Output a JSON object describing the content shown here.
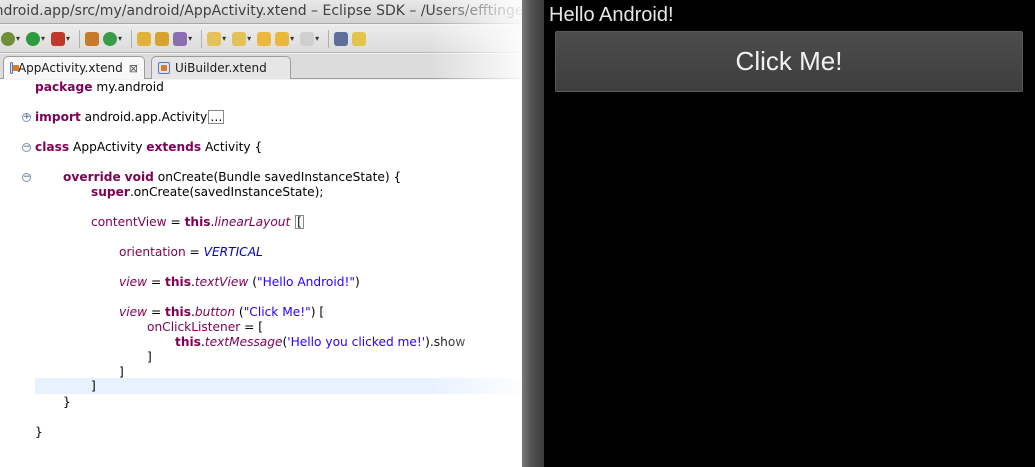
{
  "eclipse": {
    "title": "android.app/src/my/android/AppActivity.xtend – Eclipse SDK – /Users/efftinge/Doc",
    "tabs": [
      {
        "label": "AppActivity.xtend",
        "close": "⊠",
        "active": true
      },
      {
        "label": "UiBuilder.xtend",
        "active": false
      }
    ],
    "code": {
      "package_kw": "package",
      "package_name": " my.android",
      "import_kw": "import",
      "import_name": " android.app.Activity",
      "import_more": "…",
      "class_kw": "class",
      "class_name": " AppActivity ",
      "extends_kw": "extends",
      "super_name": " Activity {",
      "override_kw": "override",
      "void_kw": "void",
      "method_sig": " onCreate(Bundle savedInstanceState) {",
      "super_kw": "super",
      "super_call": ".onCreate(savedInstanceState);",
      "contentview": "contentView",
      "assign1": " = ",
      "this1": "this",
      "dot1": ".",
      "linear": "linearLayout",
      "open1": "[",
      "orientation": "orientation",
      "assign2": " = ",
      "vertical": "VERTICAL",
      "view1": "view",
      "assign3": " = ",
      "this2": "this",
      "dot2": ".",
      "textview": "textView",
      "tv_open": " (",
      "hello_str": "\"Hello Android!\"",
      "tv_close": ")",
      "view2": "view",
      "assign4": " = ",
      "this3": "this",
      "dot3": ".",
      "button": "button",
      "bt_open": " (",
      "click_str": "\"Click Me!\"",
      "bt_close": ") [",
      "onclick": "onClickListener",
      "onclick_rest": " = [",
      "this4": "this",
      "dot4": ".",
      "textmessage": "textMessage",
      "tm_open": "(",
      "tm_str": "'Hello you clicked me!'",
      "tm_close": ").show",
      "close_inner": "]",
      "close_button": "]",
      "close_layout": "]",
      "close_method": "}",
      "close_class": "}"
    }
  },
  "android": {
    "label": "Hello Android!",
    "button": "Click Me!"
  }
}
